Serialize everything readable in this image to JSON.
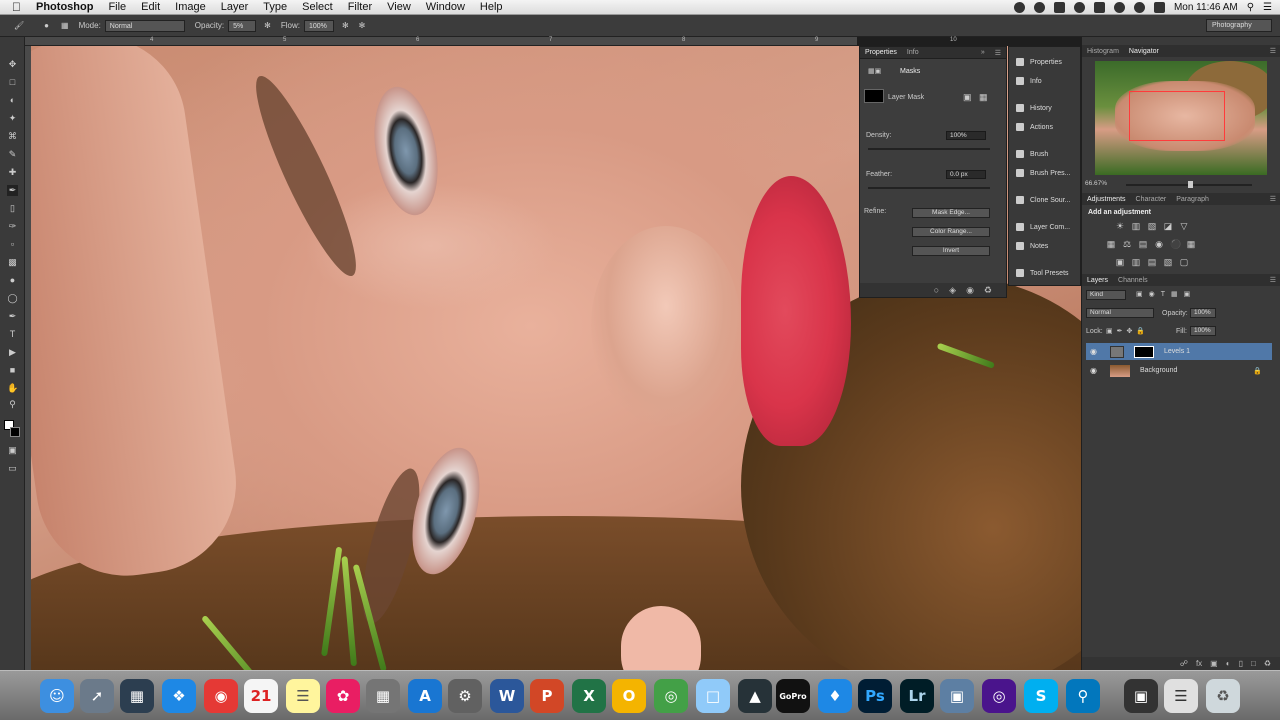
{
  "menubar": {
    "app": "Photoshop",
    "items": [
      "File",
      "Edit",
      "Image",
      "Layer",
      "Type",
      "Select",
      "Filter",
      "View",
      "Window",
      "Help"
    ],
    "clock": "Mon 11:46 AM"
  },
  "options": {
    "mode_label": "Mode:",
    "mode_value": "Normal",
    "opacity_label": "Opacity:",
    "opacity_value": "5%",
    "flow_label": "Flow:",
    "flow_value": "100%",
    "workspace": "Photography"
  },
  "ruler": {
    "ticks": [
      "4",
      "5",
      "6",
      "7",
      "8",
      "9",
      "10"
    ]
  },
  "properties": {
    "tabs": [
      "Properties",
      "Info"
    ],
    "masks_title": "Masks",
    "layer_mask_label": "Layer Mask",
    "density_label": "Density:",
    "density_value": "100%",
    "feather_label": "Feather:",
    "feather_value": "0.0 px",
    "refine_label": "Refine:",
    "btn_mask_edge": "Mask Edge...",
    "btn_color_range": "Color Range...",
    "btn_invert": "Invert"
  },
  "dock_panels": [
    "Properties",
    "Info",
    "History",
    "Actions",
    "Brush",
    "Brush Pres...",
    "Clone Sour...",
    "Layer Com...",
    "Notes",
    "Tool Presets"
  ],
  "navigator": {
    "tabs": [
      "Histogram",
      "Navigator"
    ],
    "zoom": "66.67%"
  },
  "adjustments": {
    "tabs": [
      "Adjustments",
      "Character",
      "Paragraph"
    ],
    "title": "Add an adjustment"
  },
  "layers": {
    "tabs": [
      "Layers",
      "Channels"
    ],
    "kind": "Kind",
    "blend": "Normal",
    "opacity_label": "Opacity:",
    "opacity_value": "100%",
    "lock_label": "Lock:",
    "fill_label": "Fill:",
    "fill_value": "100%",
    "items": [
      {
        "name": "Levels 1",
        "selected": true
      },
      {
        "name": "Background",
        "selected": false
      }
    ]
  },
  "colors": {
    "accent": "#5078a8",
    "lips": "#d9344a"
  },
  "dock_apps": [
    "W",
    "P",
    "X",
    "O",
    "Ps",
    "Lr",
    "S"
  ]
}
